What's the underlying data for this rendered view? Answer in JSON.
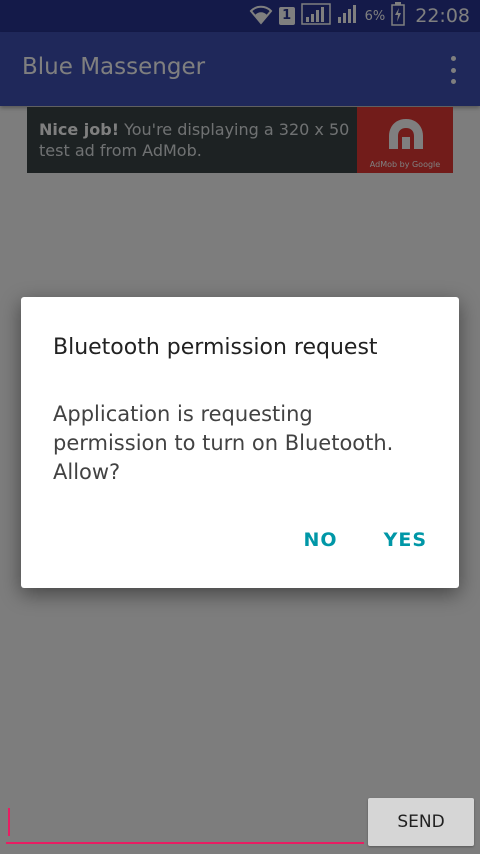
{
  "status_bar": {
    "sim_slot": "1",
    "battery_percent": "6%",
    "time": "22:08",
    "icons": [
      "wifi-icon",
      "signal-icon",
      "signal-icon",
      "battery-charging-icon"
    ]
  },
  "app_bar": {
    "title": "Blue Massenger",
    "overflow_icon": "more-vert-icon"
  },
  "ad": {
    "headline": "Nice job!",
    "body": " You're displaying a 320 x 50 test ad from AdMob.",
    "logo_caption": "AdMob by Google"
  },
  "dialog": {
    "title": "Bluetooth permission request",
    "message": "Application is requesting permission to turn on Bluetooth. Allow?",
    "negative_label": "NO",
    "positive_label": "YES"
  },
  "composer": {
    "input_value": "",
    "input_placeholder": "",
    "send_label": "SEND"
  },
  "colors": {
    "status_bar": "#283593",
    "app_bar": "#3f51b5",
    "accent": "#e91e63",
    "dialog_button": "#0097a7",
    "ad_background": "#3a4447",
    "ad_logo": "#e53935"
  }
}
